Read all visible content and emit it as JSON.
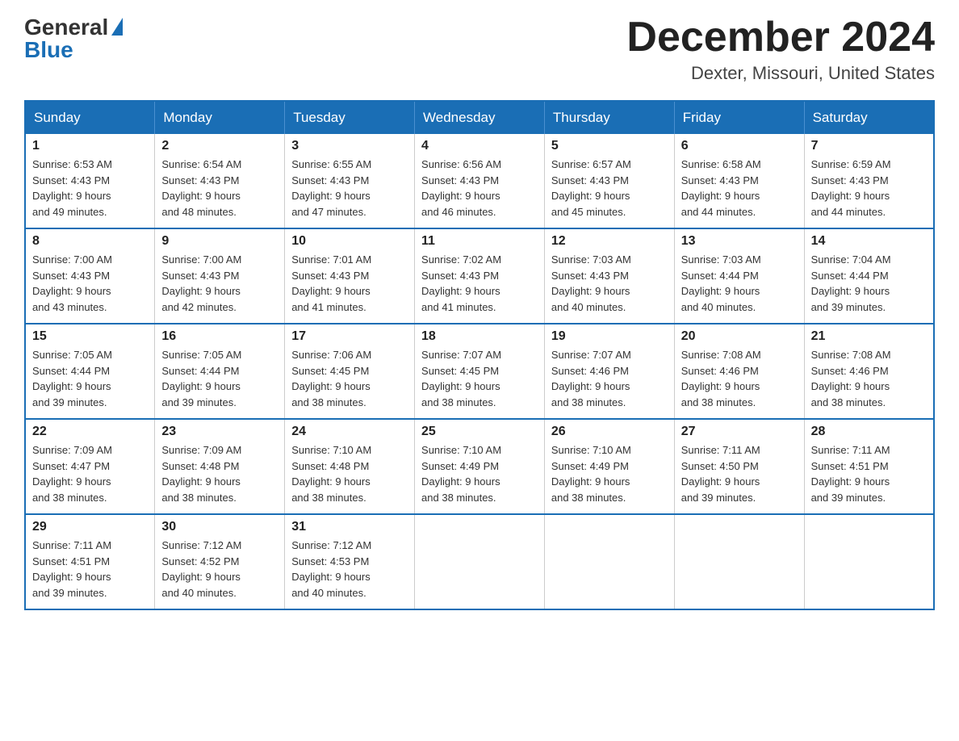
{
  "logo": {
    "general": "General",
    "blue": "Blue"
  },
  "title": "December 2024",
  "location": "Dexter, Missouri, United States",
  "days_of_week": [
    "Sunday",
    "Monday",
    "Tuesday",
    "Wednesday",
    "Thursday",
    "Friday",
    "Saturday"
  ],
  "weeks": [
    [
      {
        "day": "1",
        "sunrise": "6:53 AM",
        "sunset": "4:43 PM",
        "daylight": "9 hours and 49 minutes."
      },
      {
        "day": "2",
        "sunrise": "6:54 AM",
        "sunset": "4:43 PM",
        "daylight": "9 hours and 48 minutes."
      },
      {
        "day": "3",
        "sunrise": "6:55 AM",
        "sunset": "4:43 PM",
        "daylight": "9 hours and 47 minutes."
      },
      {
        "day": "4",
        "sunrise": "6:56 AM",
        "sunset": "4:43 PM",
        "daylight": "9 hours and 46 minutes."
      },
      {
        "day": "5",
        "sunrise": "6:57 AM",
        "sunset": "4:43 PM",
        "daylight": "9 hours and 45 minutes."
      },
      {
        "day": "6",
        "sunrise": "6:58 AM",
        "sunset": "4:43 PM",
        "daylight": "9 hours and 44 minutes."
      },
      {
        "day": "7",
        "sunrise": "6:59 AM",
        "sunset": "4:43 PM",
        "daylight": "9 hours and 44 minutes."
      }
    ],
    [
      {
        "day": "8",
        "sunrise": "7:00 AM",
        "sunset": "4:43 PM",
        "daylight": "9 hours and 43 minutes."
      },
      {
        "day": "9",
        "sunrise": "7:00 AM",
        "sunset": "4:43 PM",
        "daylight": "9 hours and 42 minutes."
      },
      {
        "day": "10",
        "sunrise": "7:01 AM",
        "sunset": "4:43 PM",
        "daylight": "9 hours and 41 minutes."
      },
      {
        "day": "11",
        "sunrise": "7:02 AM",
        "sunset": "4:43 PM",
        "daylight": "9 hours and 41 minutes."
      },
      {
        "day": "12",
        "sunrise": "7:03 AM",
        "sunset": "4:43 PM",
        "daylight": "9 hours and 40 minutes."
      },
      {
        "day": "13",
        "sunrise": "7:03 AM",
        "sunset": "4:44 PM",
        "daylight": "9 hours and 40 minutes."
      },
      {
        "day": "14",
        "sunrise": "7:04 AM",
        "sunset": "4:44 PM",
        "daylight": "9 hours and 39 minutes."
      }
    ],
    [
      {
        "day": "15",
        "sunrise": "7:05 AM",
        "sunset": "4:44 PM",
        "daylight": "9 hours and 39 minutes."
      },
      {
        "day": "16",
        "sunrise": "7:05 AM",
        "sunset": "4:44 PM",
        "daylight": "9 hours and 39 minutes."
      },
      {
        "day": "17",
        "sunrise": "7:06 AM",
        "sunset": "4:45 PM",
        "daylight": "9 hours and 38 minutes."
      },
      {
        "day": "18",
        "sunrise": "7:07 AM",
        "sunset": "4:45 PM",
        "daylight": "9 hours and 38 minutes."
      },
      {
        "day": "19",
        "sunrise": "7:07 AM",
        "sunset": "4:46 PM",
        "daylight": "9 hours and 38 minutes."
      },
      {
        "day": "20",
        "sunrise": "7:08 AM",
        "sunset": "4:46 PM",
        "daylight": "9 hours and 38 minutes."
      },
      {
        "day": "21",
        "sunrise": "7:08 AM",
        "sunset": "4:46 PM",
        "daylight": "9 hours and 38 minutes."
      }
    ],
    [
      {
        "day": "22",
        "sunrise": "7:09 AM",
        "sunset": "4:47 PM",
        "daylight": "9 hours and 38 minutes."
      },
      {
        "day": "23",
        "sunrise": "7:09 AM",
        "sunset": "4:48 PM",
        "daylight": "9 hours and 38 minutes."
      },
      {
        "day": "24",
        "sunrise": "7:10 AM",
        "sunset": "4:48 PM",
        "daylight": "9 hours and 38 minutes."
      },
      {
        "day": "25",
        "sunrise": "7:10 AM",
        "sunset": "4:49 PM",
        "daylight": "9 hours and 38 minutes."
      },
      {
        "day": "26",
        "sunrise": "7:10 AM",
        "sunset": "4:49 PM",
        "daylight": "9 hours and 38 minutes."
      },
      {
        "day": "27",
        "sunrise": "7:11 AM",
        "sunset": "4:50 PM",
        "daylight": "9 hours and 39 minutes."
      },
      {
        "day": "28",
        "sunrise": "7:11 AM",
        "sunset": "4:51 PM",
        "daylight": "9 hours and 39 minutes."
      }
    ],
    [
      {
        "day": "29",
        "sunrise": "7:11 AM",
        "sunset": "4:51 PM",
        "daylight": "9 hours and 39 minutes."
      },
      {
        "day": "30",
        "sunrise": "7:12 AM",
        "sunset": "4:52 PM",
        "daylight": "9 hours and 40 minutes."
      },
      {
        "day": "31",
        "sunrise": "7:12 AM",
        "sunset": "4:53 PM",
        "daylight": "9 hours and 40 minutes."
      },
      null,
      null,
      null,
      null
    ]
  ],
  "labels": {
    "sunrise": "Sunrise:",
    "sunset": "Sunset:",
    "daylight": "Daylight:"
  }
}
